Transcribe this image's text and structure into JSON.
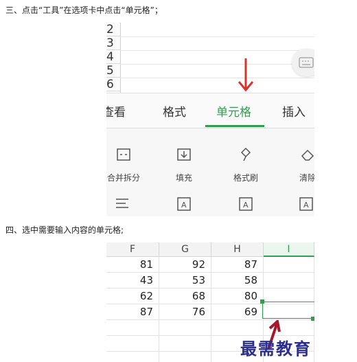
{
  "steps": {
    "step3": "三、点击“工具”在选项卡中点击“单元格”；",
    "step4": "四、选中需要输入内容的单元格;"
  },
  "shot1": {
    "row_numbers": [
      "2",
      "3",
      "4",
      "5",
      "6"
    ],
    "tabs": [
      "查看",
      "格式",
      "单元格",
      "插入"
    ],
    "active_tab": "单元格",
    "tools": [
      {
        "label": "合并拆分",
        "icon": "merge-split-icon"
      },
      {
        "label": "填充",
        "icon": "fill-icon"
      },
      {
        "label": "格式刷",
        "icon": "format-painter-icon"
      },
      {
        "label": "清除",
        "icon": "eraser-icon"
      }
    ],
    "accent_color": "#2e9e4f",
    "arrow_color": "#d9342b"
  },
  "shot2": {
    "columns": [
      "F",
      "G",
      "H",
      "I"
    ],
    "rows": [
      [
        "81",
        "92",
        "87",
        ""
      ],
      [
        "43",
        "53",
        "58",
        ""
      ],
      [
        "62",
        "68",
        "80",
        ""
      ],
      [
        "87",
        "76",
        "69",
        ""
      ]
    ],
    "watermark": "最需教育"
  }
}
